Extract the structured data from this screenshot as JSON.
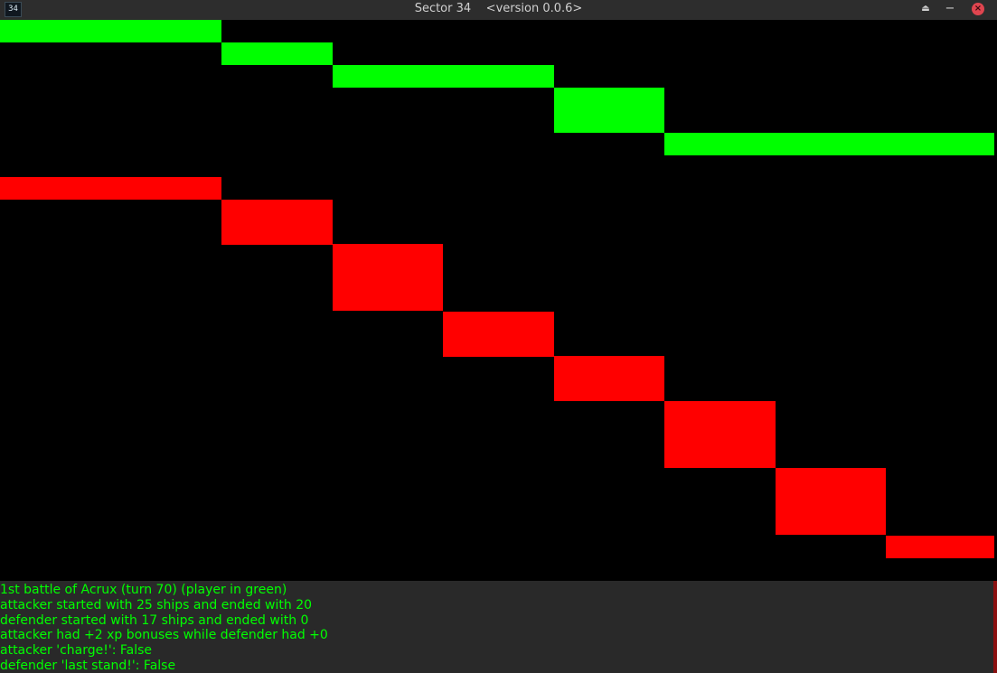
{
  "window": {
    "icon_label": "34",
    "title": "Sector 34    <version 0.0.6>",
    "shade_icon": "eject-icon",
    "minimize_icon": "minus-icon",
    "close_icon": "close-x-icon"
  },
  "colors": {
    "player": "#00ff00",
    "enemy": "#ff0000",
    "background": "#000000",
    "log_background": "#292929",
    "log_text": "#00ff00"
  },
  "chart_data": {
    "type": "step",
    "turns": 9,
    "series": [
      {
        "name": "attacker",
        "color": "#00ff00",
        "values": [
          25,
          24,
          23,
          23,
          22,
          20,
          20,
          20,
          20
        ]
      },
      {
        "name": "defender",
        "color": "#ff0000",
        "values": [
          17,
          16,
          14,
          11,
          9,
          7,
          4,
          1,
          0
        ]
      }
    ]
  },
  "log": {
    "lines": [
      "1st battle of Acrux (turn 70) (player in green)",
      "attacker started with 25 ships and ended with 20",
      "defender started with 17 ships and ended with 0",
      "attacker had +2 xp bonuses while defender had +0",
      "attacker 'charge!': False",
      "defender 'last stand!': False"
    ]
  }
}
